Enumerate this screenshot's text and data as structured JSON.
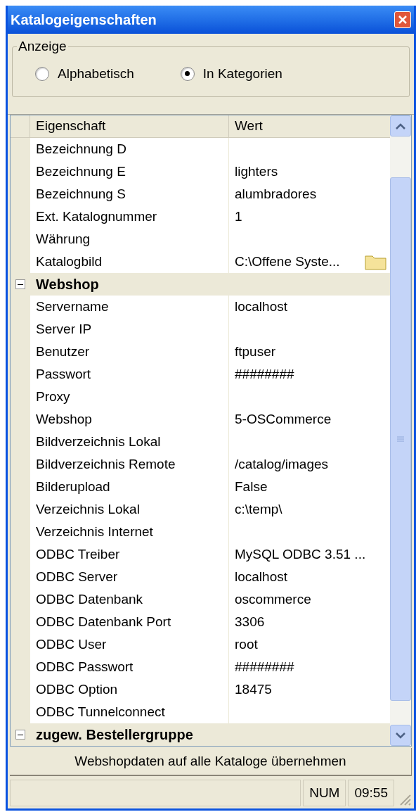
{
  "window": {
    "title": "Katalogeigenschaften"
  },
  "view": {
    "label": "Anzeige",
    "options": [
      {
        "label": "Alphabetisch",
        "selected": false
      },
      {
        "label": "In Kategorien",
        "selected": true
      }
    ]
  },
  "grid": {
    "columns": [
      "Eigenschaft",
      "Wert"
    ],
    "rows": [
      {
        "kind": "property",
        "name": "Bezeichnung D",
        "value": ""
      },
      {
        "kind": "property",
        "name": "Bezeichnung E",
        "value": "lighters"
      },
      {
        "kind": "property",
        "name": "Bezeichnung S",
        "value": "alumbradores"
      },
      {
        "kind": "property",
        "name": "Ext. Katalognummer",
        "value": "1"
      },
      {
        "kind": "property",
        "name": "Währung",
        "value": ""
      },
      {
        "kind": "file",
        "name": "Katalogbild",
        "value": "C:\\Offene Syste..."
      },
      {
        "kind": "category",
        "name": "Webshop",
        "expanded": true
      },
      {
        "kind": "property",
        "name": "Servername",
        "value": "localhost"
      },
      {
        "kind": "property",
        "name": "Server IP",
        "value": ""
      },
      {
        "kind": "property",
        "name": "Benutzer",
        "value": "ftpuser"
      },
      {
        "kind": "property",
        "name": "Passwort",
        "value": "########"
      },
      {
        "kind": "property",
        "name": "Proxy",
        "value": ""
      },
      {
        "kind": "property",
        "name": "Webshop",
        "value": "5-OSCommerce"
      },
      {
        "kind": "property",
        "name": "Bildverzeichnis Lokal",
        "value": ""
      },
      {
        "kind": "property",
        "name": "Bildverzeichnis Remote",
        "value": "/catalog/images"
      },
      {
        "kind": "property",
        "name": "Bilderupload",
        "value": "False"
      },
      {
        "kind": "property",
        "name": "Verzeichnis Lokal",
        "value": "c:\\temp\\"
      },
      {
        "kind": "property",
        "name": "Verzeichnis Internet",
        "value": ""
      },
      {
        "kind": "property",
        "name": "ODBC Treiber",
        "value": "MySQL ODBC 3.51 ..."
      },
      {
        "kind": "property",
        "name": "ODBC Server",
        "value": "localhost"
      },
      {
        "kind": "property",
        "name": "ODBC Datenbank",
        "value": "oscommerce"
      },
      {
        "kind": "property",
        "name": "ODBC Datenbank Port",
        "value": "3306"
      },
      {
        "kind": "property",
        "name": "ODBC User",
        "value": "root"
      },
      {
        "kind": "property",
        "name": "ODBC Passwort",
        "value": "########"
      },
      {
        "kind": "property",
        "name": "ODBC Option",
        "value": "18475"
      },
      {
        "kind": "property",
        "name": "ODBC Tunnelconnect",
        "value": ""
      },
      {
        "kind": "category",
        "name": "zugew. Bestellergruppe",
        "expanded": true
      }
    ]
  },
  "action_button": "Webshopdaten auf alle Kataloge übernehmen",
  "status_bar": {
    "panels": [
      "NUM",
      "09:55"
    ]
  }
}
